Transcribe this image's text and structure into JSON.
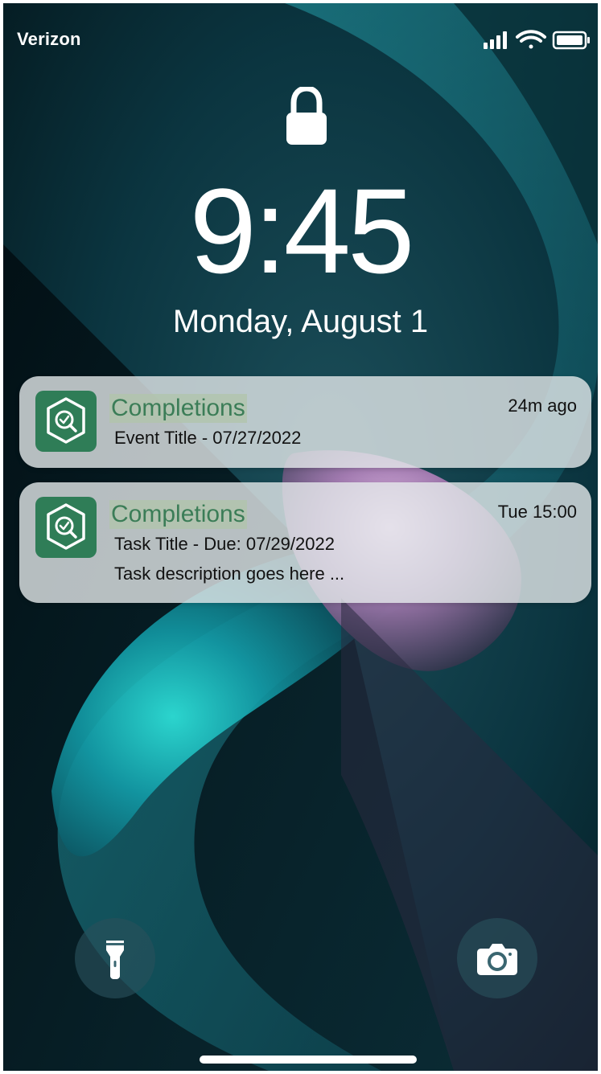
{
  "status_bar": {
    "carrier": "Verizon",
    "signal_icon": "cellular-signal-icon",
    "wifi_icon": "wifi-icon",
    "battery_icon": "battery-icon"
  },
  "lock_icon": "lock-icon",
  "clock": {
    "time": "9:45",
    "date": "Monday, August 1"
  },
  "notifications": [
    {
      "app_name": "Completions",
      "time": "24m ago",
      "lines": [
        "Event Title - 07/27/2022"
      ],
      "icon": "completions-app-icon"
    },
    {
      "app_name": "Completions",
      "time": "Tue 15:00",
      "lines": [
        "Task Title - Due: 07/29/2022",
        "Task description goes here ..."
      ],
      "icon": "completions-app-icon"
    }
  ],
  "quick_actions": {
    "flashlight_icon": "flashlight-icon",
    "camera_icon": "camera-icon"
  },
  "colors": {
    "app_icon_bg": "#2f7d57",
    "app_name_text": "#3b7d57",
    "app_name_highlight": "#b0c4aa",
    "notification_bg": "#e4e8ea",
    "wallpaper_base": "#062a30",
    "wallpaper_teal": "#1fd6d0",
    "wallpaper_pink": "#e9b6ec"
  }
}
